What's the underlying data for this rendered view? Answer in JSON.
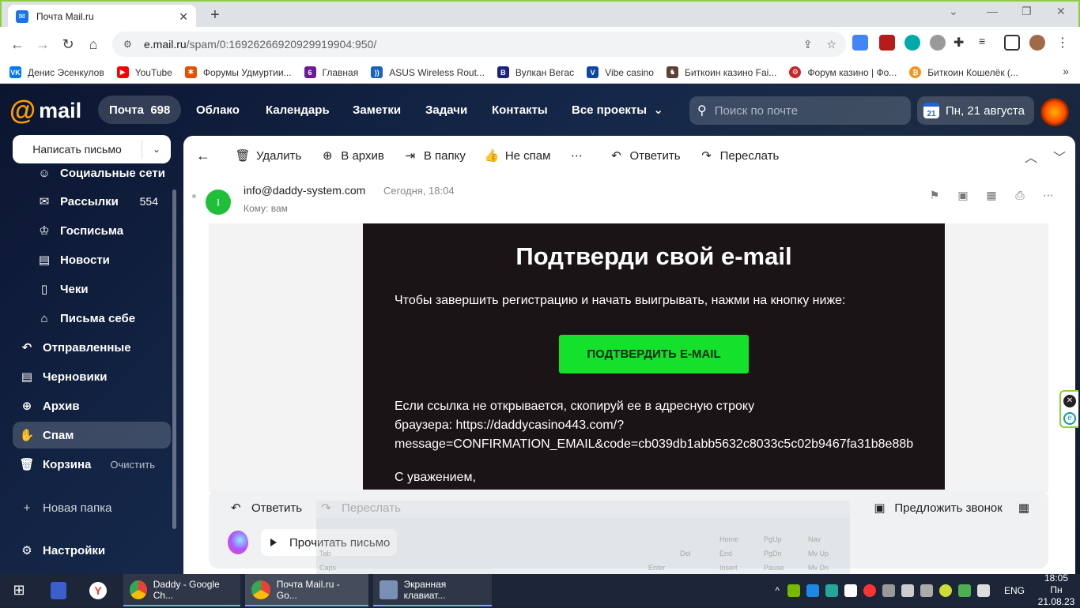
{
  "browser": {
    "tab_title": "Почта Mail.ru",
    "url_host": "e.mail.ru",
    "url_path": "/spam/0:16926266920929919904:950/",
    "bookmarks": [
      {
        "label": "Денис Эсенкулов",
        "icon": "vk-icon",
        "color": "#0077ff"
      },
      {
        "label": "YouTube",
        "icon": "youtube-icon",
        "color": "#ff0000"
      },
      {
        "label": "Форумы Удмуртии...",
        "icon": "forum-icon",
        "color": "#e65100"
      },
      {
        "label": "Главная",
        "icon": "ring-icon",
        "color": "#6a1b9a"
      },
      {
        "label": "ASUS Wireless Rout...",
        "icon": "wifi-icon",
        "color": "#1565c0"
      },
      {
        "label": "Вулкан Вегас",
        "icon": "b-icon",
        "color": "#1a237e"
      },
      {
        "label": "Vibe casino",
        "icon": "v-icon",
        "color": "#0d47a1"
      },
      {
        "label": "Биткоин казино Fai...",
        "icon": "casino-icon",
        "color": "#5d4037"
      },
      {
        "label": "Форум казино | Фо...",
        "icon": "gear-icon",
        "color": "#c62828"
      },
      {
        "label": "Биткоин Кошелёк (...",
        "icon": "bitcoin-icon",
        "color": "#f7931a"
      }
    ]
  },
  "mail": {
    "logo": "mail",
    "nav": {
      "mail_label": "Почта",
      "mail_count": "698",
      "cloud": "Облако",
      "calendar": "Календарь",
      "notes": "Заметки",
      "tasks": "Задачи",
      "contacts": "Контакты",
      "all_projects": "Все проекты"
    },
    "search_placeholder": "Поиск по почте",
    "date_label": "Пн, 21 августа",
    "date_day": "21",
    "compose": "Написать письмо",
    "folders": {
      "social": "Социальные сети",
      "newsletters": "Рассылки",
      "newsletters_count": "554",
      "gov": "Госписьма",
      "news": "Новости",
      "receipts": "Чеки",
      "self": "Письма себе",
      "sent": "Отправленные",
      "drafts": "Черновики",
      "archive": "Архив",
      "spam": "Спам",
      "trash": "Корзина",
      "trash_action": "Очистить",
      "new_folder": "Новая папка",
      "settings": "Настройки"
    },
    "actions": {
      "delete": "Удалить",
      "archive": "В архив",
      "to_folder": "В папку",
      "not_spam": "Не спам",
      "reply": "Ответить",
      "forward": "Переслать"
    },
    "message": {
      "avatar_letter": "I",
      "from": "info@daddy-system.com",
      "when": "Сегодня, 18:04",
      "to": "Кому: вам",
      "title": "Подтверди свой e-mail",
      "text": "Чтобы завершить регистрацию и начать выигрывать, нажми на кнопку ниже:",
      "button": "ПОДТВЕРДИТЬ E-MAIL",
      "fallback_1": "Если ссылка не открывается, скопируй ее в адресную строку",
      "fallback_2": "браузера: https://daddycasino443.com/?",
      "fallback_3": "message=CONFIRMATION_EMAIL&code=cb039db1abb5632c8033c5c02b9467fa31b8e88b",
      "sign": "С уважением,"
    },
    "bottom": {
      "reply": "Ответить",
      "forward": "Переслать",
      "call": "Предложить звонок",
      "read": "Прочитать письмо"
    }
  },
  "taskbar": {
    "items": [
      {
        "label": "Daddy - Google Ch..."
      },
      {
        "label": "Почта Mail.ru - Go..."
      },
      {
        "label": "Экранная клавиат..."
      }
    ],
    "lang": "ENG",
    "time": "18:05",
    "date": "Пн 21.08.23"
  },
  "colors": {
    "accent_green": "#14e12b",
    "email_bg": "#1b1416",
    "mail_bg": "#15284a"
  }
}
